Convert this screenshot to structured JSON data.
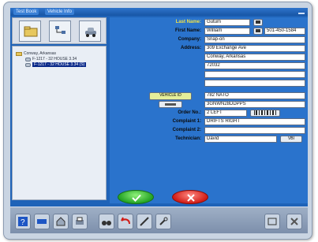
{
  "window": {
    "menu_1": "Test Book",
    "menu_2": "Vehicle Info"
  },
  "tree": {
    "root_label": "Conway, Arkansas",
    "vehicles": [
      "F-1217 - 32 HOUSE 3.34",
      "F-1217 - 32 HOUSE 3.34 (S)"
    ]
  },
  "form": {
    "last_name_label": "Last Name:",
    "last_name": "Gutum",
    "first_name_label": "First Name:",
    "first_name": "William",
    "phone": "501-450-1584",
    "company_label": "Company:",
    "company": "Snap-on",
    "address_label": "Address:",
    "address_1": "309 Exchange Ave",
    "address_2": "Conway, Arkansas",
    "address_3": "72032",
    "vehicle_id_button": "VEHICLE ID",
    "vehicle_model": "782 NATO",
    "vin": "3GNWN28DDPPS",
    "order_no_label": "Order No.:",
    "order_no": "2 LEFT",
    "complaint1_label": "Complaint 1:",
    "complaint1": "DRIFTS RIGHT",
    "complaint2_label": "Complaint 2:",
    "complaint2": "",
    "technician_label": "Technician:",
    "technician": "David",
    "technician_btn": "VBI"
  },
  "colors": {
    "highlight_label": "#f1e34a",
    "ok": "#24a324",
    "cancel": "#d11c16",
    "background": "#1f63b8"
  }
}
